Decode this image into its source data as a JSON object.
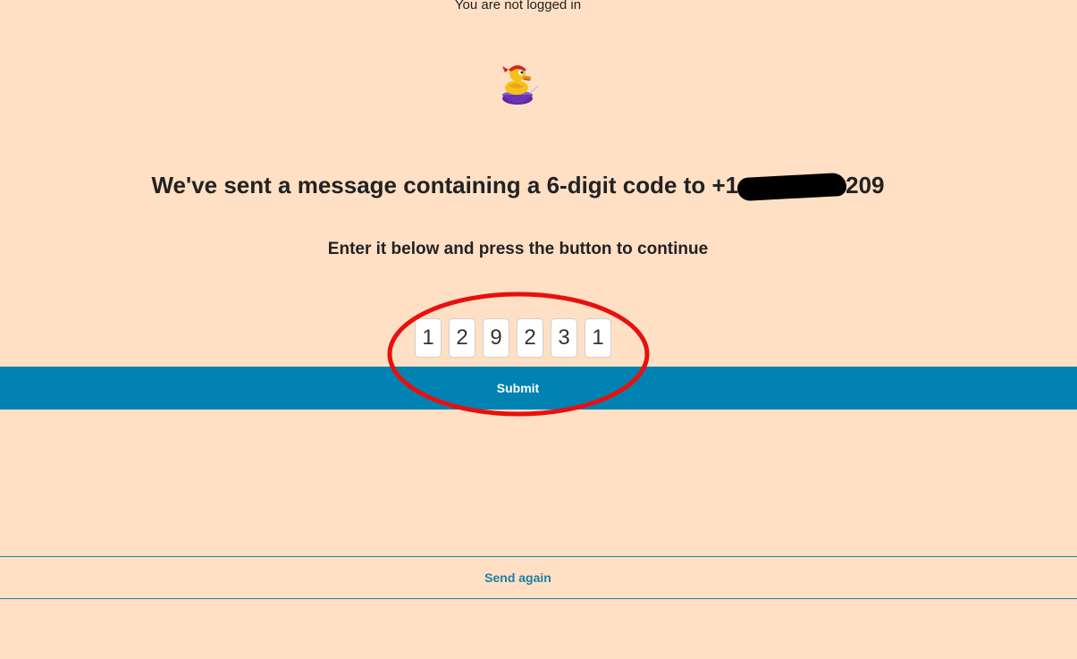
{
  "header": {
    "login_status": "You are not logged in"
  },
  "logo": {
    "icon": "duck-mascot-icon"
  },
  "verification": {
    "heading_prefix": "We've sent a message containing a 6-digit code to +1",
    "heading_suffix": "209",
    "subheading": "Enter it below and press the button to continue",
    "code_digits": [
      "1",
      "2",
      "9",
      "2",
      "3",
      "1"
    ]
  },
  "actions": {
    "submit_label": "Submit",
    "send_again_label": "Send again"
  },
  "colors": {
    "background": "#ffe0c5",
    "submit_bar": "#0082b3",
    "link": "#1a7fa6",
    "annotation": "#e8100f"
  }
}
